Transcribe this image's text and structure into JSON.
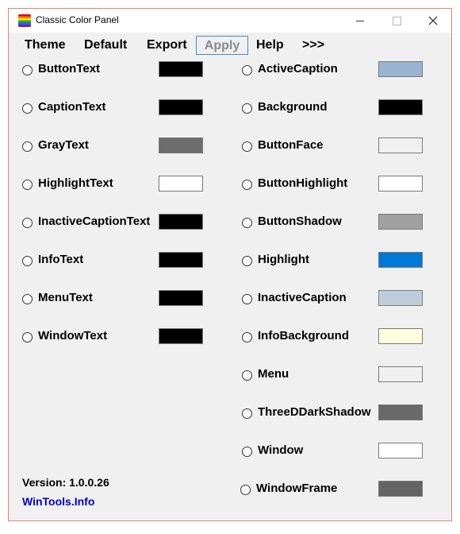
{
  "window": {
    "title": "Classic Color Panel"
  },
  "menu": {
    "theme": "Theme",
    "default": "Default",
    "export": "Export",
    "apply": "Apply",
    "help": "Help",
    "more": ">>>"
  },
  "left_items": [
    {
      "label": "ButtonText",
      "color": "#000000"
    },
    {
      "label": "CaptionText",
      "color": "#000000"
    },
    {
      "label": "GrayText",
      "color": "#6d6d6d"
    },
    {
      "label": "HighlightText",
      "color": "#ffffff"
    },
    {
      "label": "InactiveCaptionText",
      "color": "#000000"
    },
    {
      "label": "InfoText",
      "color": "#000000"
    },
    {
      "label": "MenuText",
      "color": "#000000"
    },
    {
      "label": "WindowText",
      "color": "#000000"
    }
  ],
  "right_items": [
    {
      "label": "ActiveCaption",
      "color": "#99b4d1"
    },
    {
      "label": "Background",
      "color": "#000000"
    },
    {
      "label": "ButtonFace",
      "color": "#f0f0f0"
    },
    {
      "label": "ButtonHighlight",
      "color": "#ffffff"
    },
    {
      "label": "ButtonShadow",
      "color": "#a0a0a0"
    },
    {
      "label": "Highlight",
      "color": "#0078d7"
    },
    {
      "label": "InactiveCaption",
      "color": "#bfcddb"
    },
    {
      "label": "InfoBackground",
      "color": "#ffffe1"
    },
    {
      "label": "Menu",
      "color": "#f0f0f0"
    },
    {
      "label": "ThreeDDarkShadow",
      "color": "#696969"
    },
    {
      "label": "Window",
      "color": "#ffffff"
    },
    {
      "label": "WindowFrame",
      "color": "#646464"
    }
  ],
  "footer": {
    "version": "Version: 1.0.0.26",
    "link": "WinTools.Info"
  }
}
